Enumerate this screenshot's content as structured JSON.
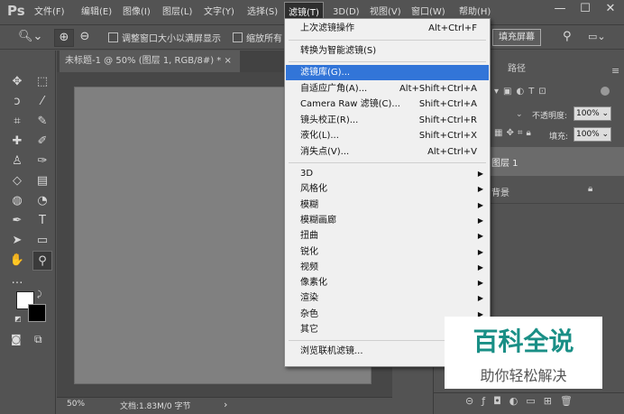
{
  "app": {
    "logo": "Ps"
  },
  "menubar": {
    "items": [
      "文件(F)",
      "编辑(E)",
      "图像(I)",
      "图层(L)",
      "文字(Y)",
      "选择(S)",
      "滤镜(T)",
      "3D(D)",
      "视图(V)",
      "窗口(W)",
      "帮助(H)"
    ],
    "active": "滤镜(T)"
  },
  "window_controls": {
    "minimize": "—",
    "maximize": "☐",
    "close": "✕"
  },
  "options": {
    "checkbox1_label": "调整窗口大小以满屏显示",
    "checkbox2_label": "缩放所有",
    "fill_screen": "填充屏幕"
  },
  "document": {
    "tab_title": "未标题-1 @ 50% (图层 1, RGB/8#) *",
    "close": "×",
    "zoom": "50%",
    "doc_info": "文档:1.83M/0 字节",
    "arrow": "›"
  },
  "panel": {
    "tab_paths": "路径",
    "opacity_label": "不透明度:",
    "opacity_value": "100%",
    "fill_label": "填充:",
    "fill_value": "100%",
    "layer1": "图层 1",
    "background": "背景"
  },
  "filter_menu": {
    "top": [
      {
        "label": "上次滤镜操作",
        "shortcut": "Alt+Ctrl+F"
      }
    ],
    "convert": "转换为智能滤镜(S)",
    "main": [
      {
        "label": "滤镜库(G)...",
        "shortcut": ""
      },
      {
        "label": "自适应广角(A)...",
        "shortcut": "Alt+Shift+Ctrl+A"
      },
      {
        "label": "Camera Raw 滤镜(C)...",
        "shortcut": "Shift+Ctrl+A"
      },
      {
        "label": "镜头校正(R)...",
        "shortcut": "Shift+Ctrl+R"
      },
      {
        "label": "液化(L)...",
        "shortcut": "Shift+Ctrl+X"
      },
      {
        "label": "消失点(V)...",
        "shortcut": "Alt+Ctrl+V"
      }
    ],
    "highlighted": "滤镜库(G)...",
    "submenus": [
      "3D",
      "风格化",
      "模糊",
      "模糊画廊",
      "扭曲",
      "锐化",
      "视频",
      "像素化",
      "渲染",
      "杂色",
      "其它"
    ],
    "browse": "浏览联机滤镜..."
  },
  "watermark": {
    "main": "百科全说",
    "sub": "助你轻松解决"
  }
}
